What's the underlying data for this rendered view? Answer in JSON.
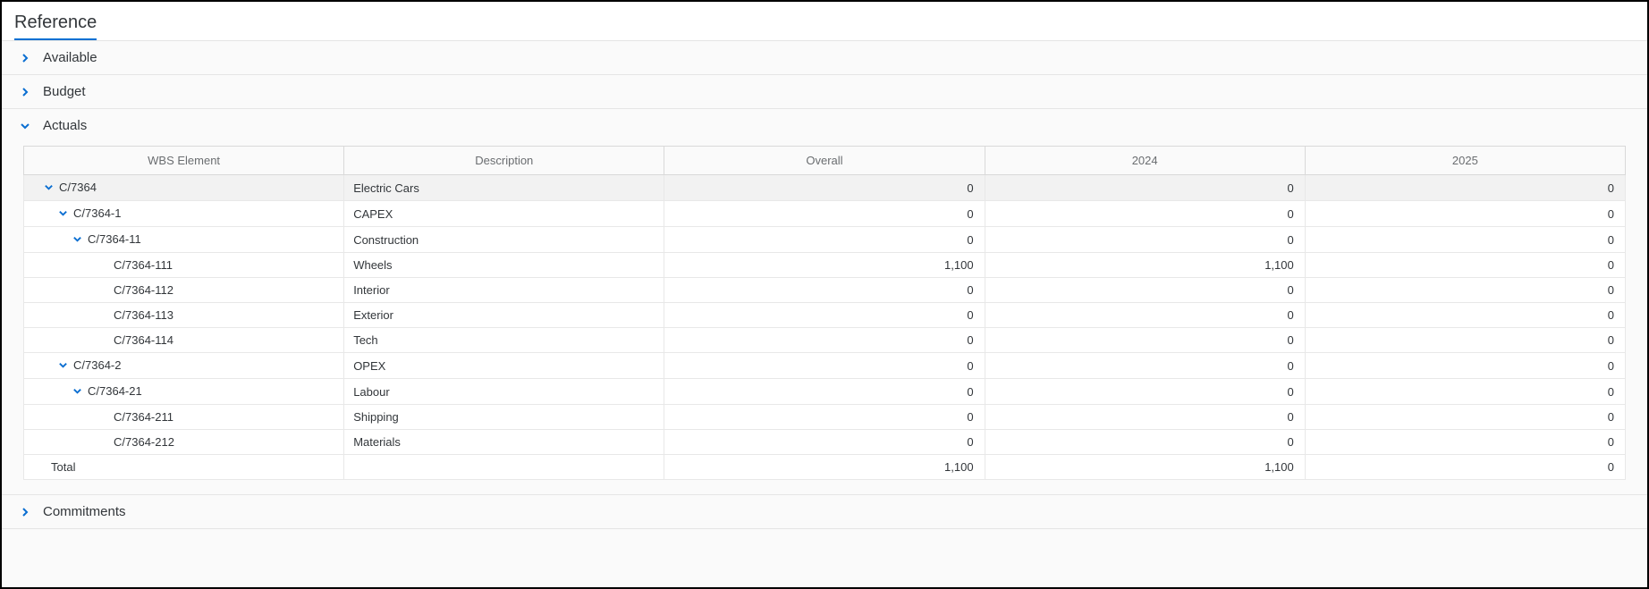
{
  "header": {
    "title": "Reference"
  },
  "sections": {
    "available": {
      "title": "Available",
      "expanded": false
    },
    "budget": {
      "title": "Budget",
      "expanded": false
    },
    "actuals": {
      "title": "Actuals",
      "expanded": true
    },
    "commitments": {
      "title": "Commitments",
      "expanded": false
    }
  },
  "actuals_table": {
    "columns": {
      "wbs": "WBS Element",
      "desc": "Description",
      "overall": "Overall",
      "y2024": "2024",
      "y2025": "2025"
    },
    "rows": [
      {
        "level": 0,
        "expandable": true,
        "highlight": true,
        "wbs": "C/7364",
        "desc": "Electric Cars",
        "overall": "0",
        "y2024": "0",
        "y2025": "0"
      },
      {
        "level": 1,
        "expandable": true,
        "wbs": "C/7364-1",
        "desc": "CAPEX",
        "overall": "0",
        "y2024": "0",
        "y2025": "0"
      },
      {
        "level": 2,
        "expandable": true,
        "wbs": "C/7364-11",
        "desc": "Construction",
        "overall": "0",
        "y2024": "0",
        "y2025": "0"
      },
      {
        "level": 3,
        "expandable": false,
        "wbs": "C/7364-111",
        "desc": "Wheels",
        "overall": "1,100",
        "y2024": "1,100",
        "y2025": "0"
      },
      {
        "level": 3,
        "expandable": false,
        "wbs": "C/7364-112",
        "desc": "Interior",
        "overall": "0",
        "y2024": "0",
        "y2025": "0"
      },
      {
        "level": 3,
        "expandable": false,
        "wbs": "C/7364-113",
        "desc": "Exterior",
        "overall": "0",
        "y2024": "0",
        "y2025": "0"
      },
      {
        "level": 3,
        "expandable": false,
        "wbs": "C/7364-114",
        "desc": "Tech",
        "overall": "0",
        "y2024": "0",
        "y2025": "0"
      },
      {
        "level": 1,
        "expandable": true,
        "wbs": "C/7364-2",
        "desc": "OPEX",
        "overall": "0",
        "y2024": "0",
        "y2025": "0"
      },
      {
        "level": 2,
        "expandable": true,
        "wbs": "C/7364-21",
        "desc": "Labour",
        "overall": "0",
        "y2024": "0",
        "y2025": "0"
      },
      {
        "level": 3,
        "expandable": false,
        "wbs": "C/7364-211",
        "desc": "Shipping",
        "overall": "0",
        "y2024": "0",
        "y2025": "0"
      },
      {
        "level": 3,
        "expandable": false,
        "wbs": "C/7364-212",
        "desc": "Materials",
        "overall": "0",
        "y2024": "0",
        "y2025": "0"
      }
    ],
    "total": {
      "label": "Total",
      "overall": "1,100",
      "y2024": "1,100",
      "y2025": "0"
    }
  }
}
